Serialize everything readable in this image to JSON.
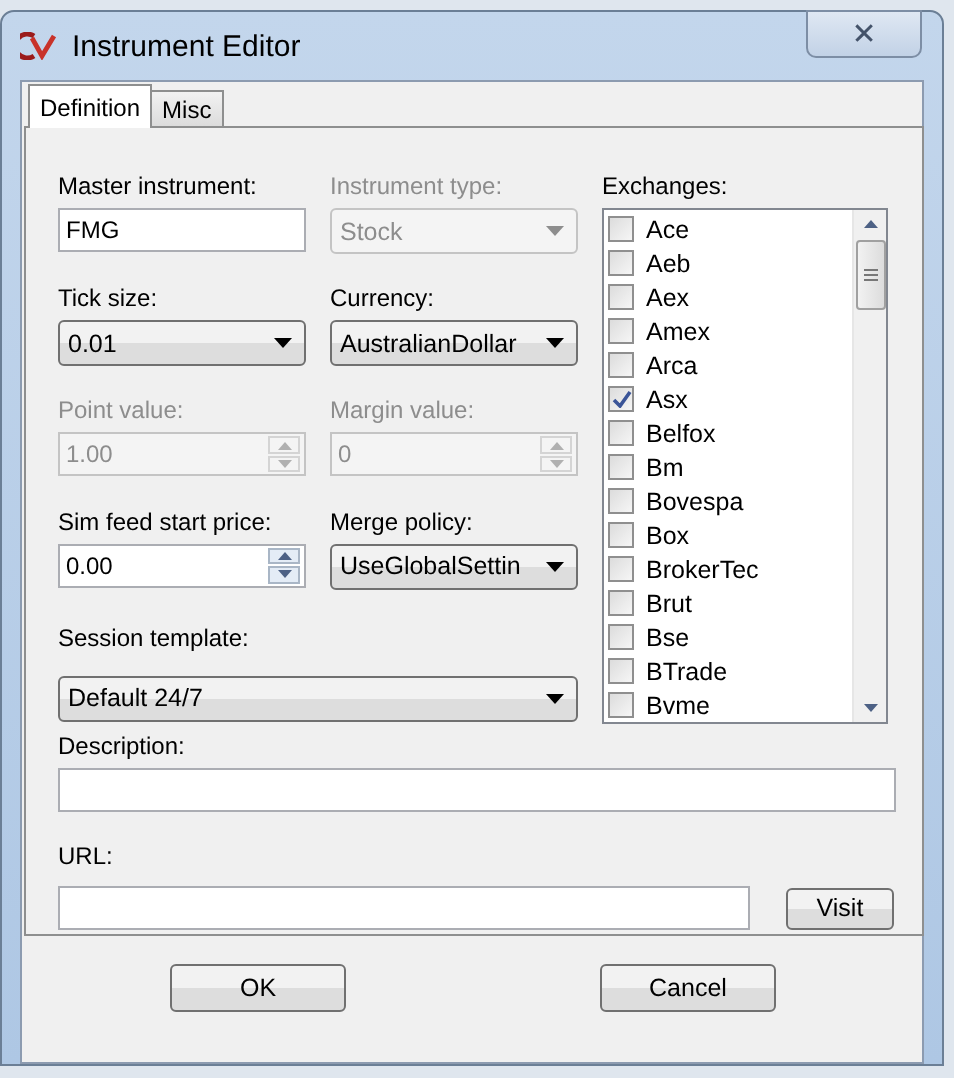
{
  "window": {
    "title": "Instrument Editor",
    "close": "✕"
  },
  "tabs": [
    {
      "label": "Definition",
      "selected": true
    },
    {
      "label": "Misc",
      "selected": false
    }
  ],
  "fields": [
    {
      "kind": "text",
      "label": "Master instrument:",
      "value": "FMG",
      "disabled": false
    },
    {
      "kind": "combo",
      "label": "Instrument type:",
      "value": "Stock",
      "disabled": true
    },
    {
      "kind": "combo",
      "label": "Tick size:",
      "value": "0.01",
      "disabled": false
    },
    {
      "kind": "combo",
      "label": "Currency:",
      "value": "AustralianDollar",
      "disabled": false
    },
    {
      "kind": "spin",
      "label": "Point value:",
      "value": "1.00",
      "disabled": true
    },
    {
      "kind": "spin",
      "label": "Margin value:",
      "value": "0",
      "disabled": true
    },
    {
      "kind": "spin",
      "label": "Sim feed start price:",
      "value": "0.00",
      "disabled": false
    },
    {
      "kind": "combo",
      "label": "Merge policy:",
      "value": "UseGlobalSettin",
      "disabled": false
    }
  ],
  "session": {
    "label": "Session template:",
    "value": "Default 24/7"
  },
  "exchanges": {
    "label": "Exchanges:",
    "items": [
      {
        "label": "Ace",
        "checked": false
      },
      {
        "label": "Aeb",
        "checked": false
      },
      {
        "label": "Aex",
        "checked": false
      },
      {
        "label": "Amex",
        "checked": false
      },
      {
        "label": "Arca",
        "checked": false
      },
      {
        "label": "Asx",
        "checked": true
      },
      {
        "label": "Belfox",
        "checked": false
      },
      {
        "label": "Bm",
        "checked": false
      },
      {
        "label": "Bovespa",
        "checked": false
      },
      {
        "label": "Box",
        "checked": false
      },
      {
        "label": "BrokerTec",
        "checked": false
      },
      {
        "label": "Brut",
        "checked": false
      },
      {
        "label": "Bse",
        "checked": false
      },
      {
        "label": "BTrade",
        "checked": false
      },
      {
        "label": "Bvme",
        "checked": false
      }
    ]
  },
  "description": {
    "label": "Description:"
  },
  "url": {
    "label": "URL:",
    "button": "Visit"
  },
  "buttons": [
    "OK",
    "Cancel"
  ]
}
